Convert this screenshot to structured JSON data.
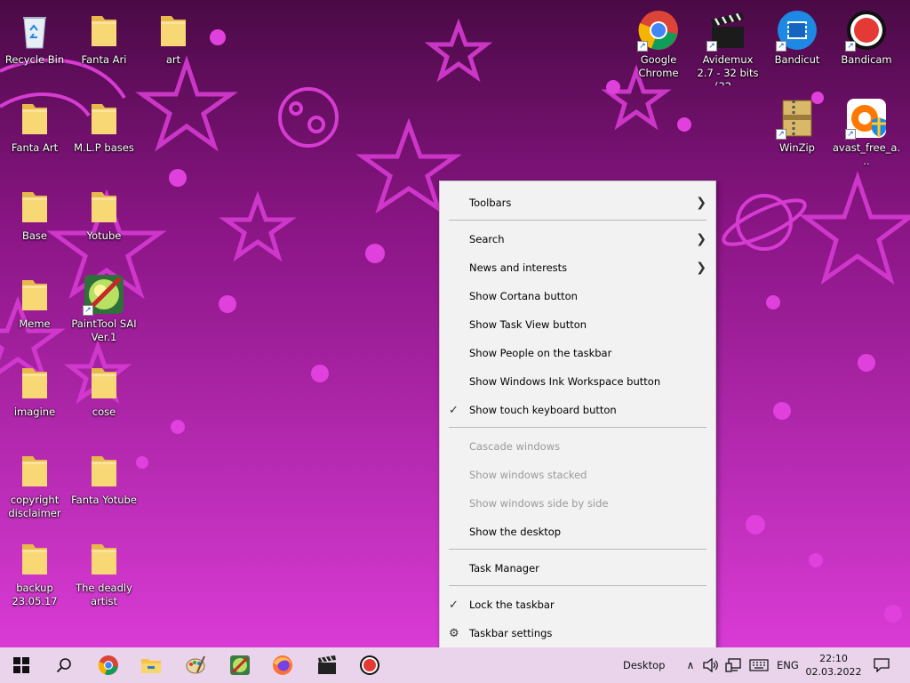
{
  "desktop": {
    "left_icons": [
      {
        "label": "Recycle Bin",
        "icon": "recycle-bin-icon"
      },
      {
        "label": "Fanta Ari",
        "icon": "folder-icon"
      },
      {
        "label": "art",
        "icon": "folder-icon"
      },
      {
        "label": "Fanta Art",
        "icon": "folder-icon"
      },
      {
        "label": "M.L.P bases",
        "icon": "folder-icon"
      },
      {
        "label": "Base",
        "icon": "folder-icon"
      },
      {
        "label": "Yotube",
        "icon": "folder-icon"
      },
      {
        "label": "Meme",
        "icon": "folder-icon"
      },
      {
        "label": "PaintTool SAI Ver.1",
        "icon": "painttool-sai-icon"
      },
      {
        "label": "imagine",
        "icon": "folder-icon"
      },
      {
        "label": "cose",
        "icon": "folder-icon"
      },
      {
        "label": "copyright disclaimer",
        "icon": "folder-icon"
      },
      {
        "label": "Fanta Yotube",
        "icon": "folder-icon"
      },
      {
        "label": "backup 23.05.17",
        "icon": "folder-icon"
      },
      {
        "label": "The deadly artist",
        "icon": "folder-icon"
      }
    ],
    "right_icons": [
      {
        "label": "Google Chrome",
        "icon": "chrome-icon"
      },
      {
        "label": "Avidemux 2.7 - 32 bits (32...",
        "icon": "avidemux-icon"
      },
      {
        "label": "Bandicut",
        "icon": "bandicut-icon"
      },
      {
        "label": "Bandicam",
        "icon": "bandicam-icon"
      },
      {
        "label": "WinZip",
        "icon": "winzip-icon"
      },
      {
        "label": "avast_free_a...",
        "icon": "avast-icon"
      }
    ]
  },
  "context_menu": {
    "items": [
      {
        "label": "Toolbars",
        "submenu": true
      },
      {
        "label": "Search",
        "submenu": true
      },
      {
        "label": "News and interests",
        "submenu": true
      },
      {
        "label": "Show Cortana button"
      },
      {
        "label": "Show Task View button"
      },
      {
        "label": "Show People on the taskbar"
      },
      {
        "label": "Show Windows Ink Workspace button"
      },
      {
        "label": "Show touch keyboard button",
        "checked": true
      },
      {
        "label": "Cascade windows",
        "disabled": true
      },
      {
        "label": "Show windows stacked",
        "disabled": true
      },
      {
        "label": "Show windows side by side",
        "disabled": true
      },
      {
        "label": "Show the desktop"
      },
      {
        "label": "Task Manager"
      },
      {
        "label": "Lock the taskbar",
        "checked": true
      },
      {
        "label": "Taskbar settings",
        "gear": true
      }
    ]
  },
  "taskbar": {
    "apps": [
      "start-icon",
      "search-icon",
      "chrome-icon",
      "file-explorer-icon",
      "paint-palette-icon",
      "painttool-sai-icon",
      "firefox-icon",
      "avidemux-icon",
      "bandicam-icon"
    ],
    "desktop_label": "Desktop",
    "language": "ENG",
    "time": "22:10",
    "date": "02.03.2022"
  },
  "colors": {
    "wallpaper_top": "#4a0a45",
    "wallpaper_bottom": "#d93bd5",
    "shape_magenta": "#e040dc",
    "taskbar_bg": "#e9d4ec",
    "menu_bg": "#f2f2f2"
  }
}
